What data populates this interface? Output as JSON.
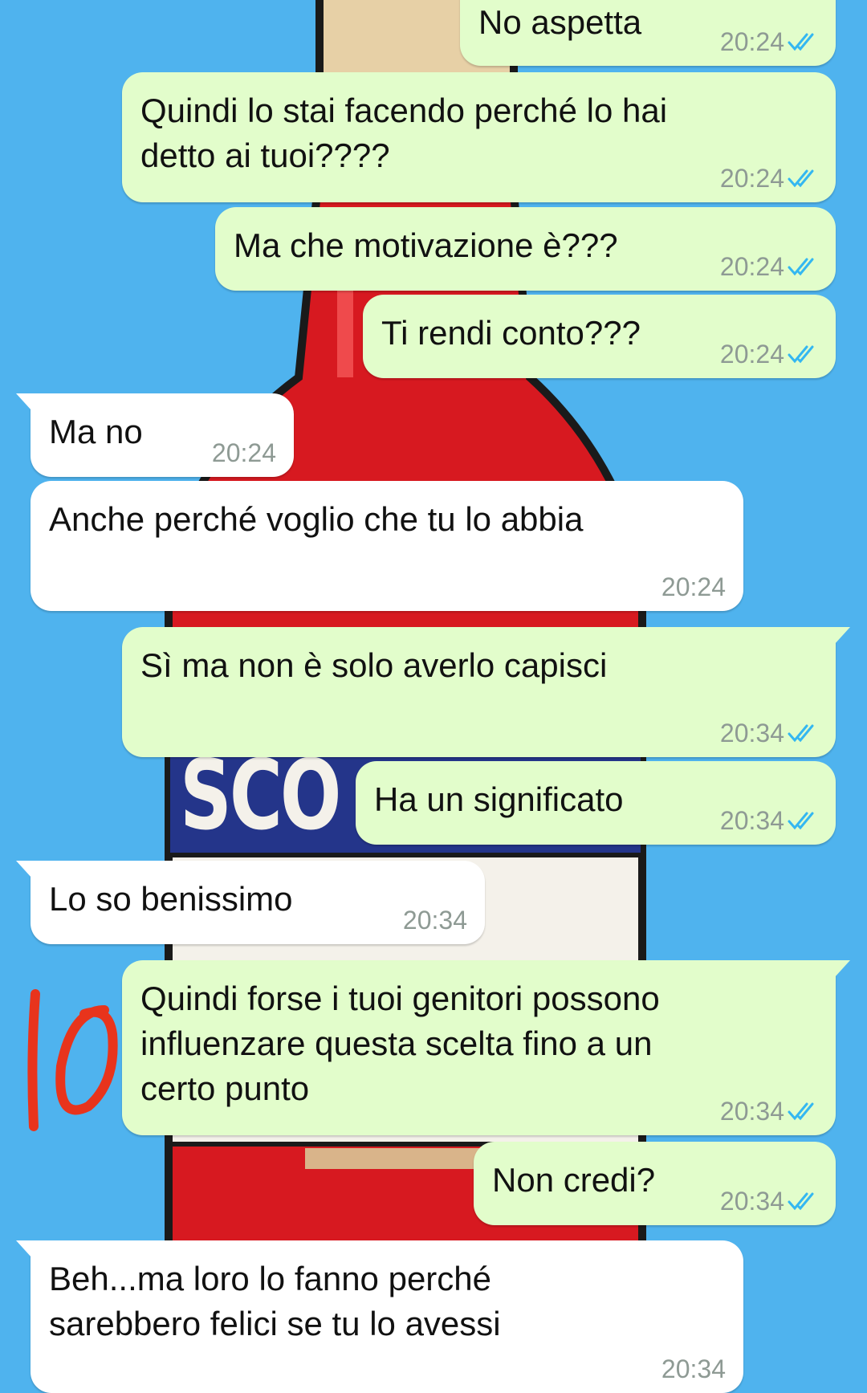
{
  "wallpaper": {
    "background_color": "#4fb3ee",
    "bottle_color": "#d71920",
    "label_text": "SCO"
  },
  "colors": {
    "outgoing_bubble": "#e2fdcb",
    "incoming_bubble": "#ffffff",
    "read_checks": "#34b7f1",
    "annotation": "#e8341c"
  },
  "annotation": {
    "text": "10"
  },
  "messages": [
    {
      "direction": "out",
      "text": "No aspetta",
      "time": "20:24",
      "status_icon": "double-check-read-icon"
    },
    {
      "direction": "out",
      "text": "Quindi lo stai facendo perché lo hai\ndetto ai tuoi????",
      "time": "20:24",
      "status_icon": "double-check-read-icon"
    },
    {
      "direction": "out",
      "text": "Ma che motivazione è???",
      "time": "20:24",
      "status_icon": "double-check-read-icon"
    },
    {
      "direction": "out",
      "text": "Ti rendi conto???",
      "time": "20:24",
      "status_icon": "double-check-read-icon"
    },
    {
      "direction": "in",
      "text": "Ma no",
      "time": "20:24"
    },
    {
      "direction": "in",
      "text": "Anche perché voglio che tu lo abbia",
      "time": "20:24"
    },
    {
      "direction": "out",
      "text": "Sì ma non è solo averlo capisci",
      "time": "20:34",
      "status_icon": "double-check-read-icon"
    },
    {
      "direction": "out",
      "text": "Ha un significato",
      "time": "20:34",
      "status_icon": "double-check-read-icon"
    },
    {
      "direction": "in",
      "text": "Lo so benissimo",
      "time": "20:34"
    },
    {
      "direction": "out",
      "text": "Quindi forse i tuoi genitori possono\ninfluenzare questa scelta fino a un\ncerto punto",
      "time": "20:34",
      "status_icon": "double-check-read-icon"
    },
    {
      "direction": "out",
      "text": "Non credi?",
      "time": "20:34",
      "status_icon": "double-check-read-icon"
    },
    {
      "direction": "in",
      "text": "Beh...ma loro lo fanno perché\nsarebbero felici se tu lo avessi",
      "time": "20:34"
    }
  ]
}
